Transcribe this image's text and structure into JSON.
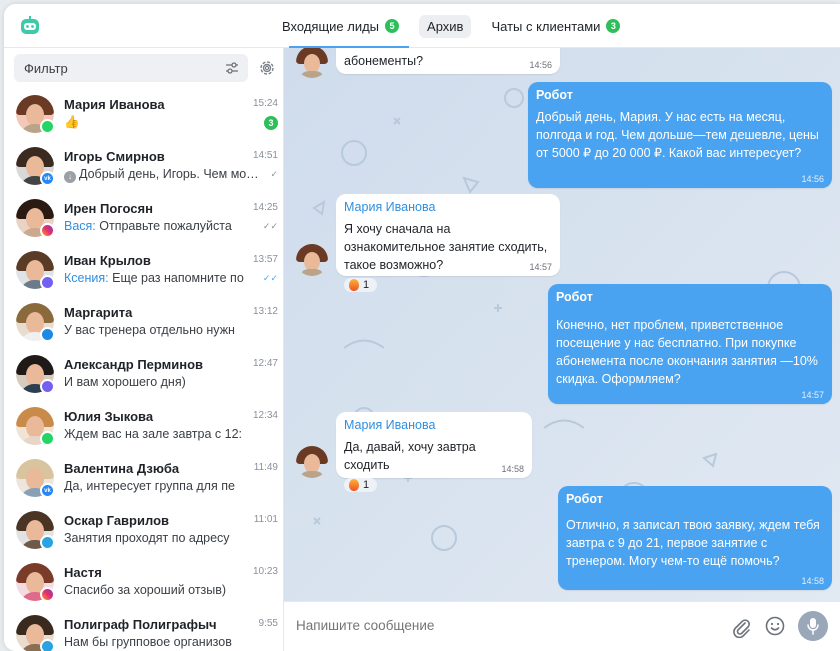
{
  "header": {
    "logo_icon": "robot-logo-icon",
    "tabs": [
      {
        "label": "Входящие лиды",
        "count": "5"
      },
      {
        "label": "Архив"
      },
      {
        "label": "Чаты с клиентами",
        "count": "3"
      }
    ]
  },
  "sidebar": {
    "filter_placeholder": "Фильтр",
    "chats": [
      {
        "name": "Мария Иванова",
        "time": "15:24",
        "preview": "👍",
        "unread": "3",
        "channel": "whatsapp-icon"
      },
      {
        "name": "Игорь Смирнов",
        "time": "14:51",
        "preview": "Добрый день, Игорь. Чем может",
        "channel": "vk-icon"
      },
      {
        "name": "Ирен Погосян",
        "time": "14:25",
        "sender": "Вася:",
        "preview": "Отправьте пожалуйста",
        "channel": "instagram-icon"
      },
      {
        "name": "Иван Крылов",
        "time": "13:57",
        "sender": "Ксения:",
        "preview": "Еще раз напомните по",
        "channel": "viber-icon"
      },
      {
        "name": "Маргарита",
        "time": "13:12",
        "preview": "У вас тренера отдельно нужн",
        "channel": "messenger-icon"
      },
      {
        "name": "Александр Перминов",
        "time": "12:47",
        "preview": "И вам хорошего дня)",
        "channel": "viber-icon"
      },
      {
        "name": "Юлия Зыкова",
        "time": "12:34",
        "preview": "Ждем вас на зале завтра с 12:",
        "channel": "whatsapp-icon"
      },
      {
        "name": "Валентина Дзюба",
        "time": "11:49",
        "preview": "Да, интересует группа для пе",
        "channel": "vk-icon"
      },
      {
        "name": "Оскар Гаврилов",
        "time": "11:01",
        "preview": "Занятия проходят по адресу",
        "channel": "telegram-icon"
      },
      {
        "name": "Настя",
        "time": "10:23",
        "preview": "Спасибо за хороший отзыв)",
        "channel": "instagram-icon"
      },
      {
        "name": "Полиграф Полиграфыч",
        "time": "9:55",
        "preview": "Нам бы групповое организов",
        "channel": "telegram-icon"
      }
    ]
  },
  "messages": [
    {
      "type": "in",
      "text": "абонементы?",
      "time": "14:56"
    },
    {
      "type": "out",
      "author": "Робот",
      "text": "Добрый день, Мария. У нас есть на месяц, полгода и год. Чем дольше—тем дешевле, цены от 5000 ₽ до 20 000 ₽. Какой вас интересует?",
      "time": "14:56"
    },
    {
      "type": "in",
      "author": "Мария Иванова",
      "text": "Я хочу сначала на ознакомительное занятие сходить, такое возможно?",
      "reaction": "1",
      "time": "14:57"
    },
    {
      "type": "out",
      "author": "Робот",
      "text": "Конечно, нет проблем, приветственное посещение у нас бесплатно. При покупке абонемента после окончания занятия —10% скидка. Оформляем?",
      "time": "14:57"
    },
    {
      "type": "in",
      "author": "Мария Иванова",
      "text": "Да, давай, хочу завтра сходить",
      "reaction": "1",
      "time": "14:58"
    },
    {
      "type": "out",
      "author": "Робот",
      "text": "Отлично, я записал твою заявку, ждем тебя завтра с 9 до 21, первое занятие с тренером. Могу чем-то ещё помочь?",
      "time": "14:58"
    }
  ],
  "composer": {
    "placeholder": "Напишите сообщение"
  },
  "colors": {
    "accent": "#4aa3f0",
    "badge": "#2fbf5a",
    "chat_bg": "#d5e1ee"
  }
}
